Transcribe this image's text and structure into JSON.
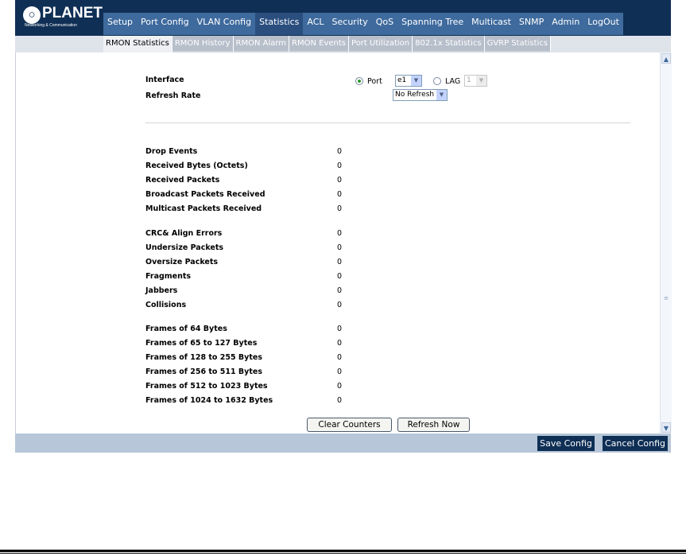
{
  "logo": {
    "word": "PLANET",
    "tagline": "Networking & Communication"
  },
  "main_menu": [
    {
      "label": "Setup",
      "active": false
    },
    {
      "label": "Port Config",
      "active": false
    },
    {
      "label": "VLAN Config",
      "active": false
    },
    {
      "label": "Statistics",
      "active": true
    },
    {
      "label": "ACL",
      "active": false
    },
    {
      "label": "Security",
      "active": false
    },
    {
      "label": "QoS",
      "active": false
    },
    {
      "label": "Spanning Tree",
      "active": false
    },
    {
      "label": "Multicast",
      "active": false
    },
    {
      "label": "SNMP",
      "active": false
    },
    {
      "label": "Admin",
      "active": false
    },
    {
      "label": "LogOut",
      "active": false
    }
  ],
  "sub_menu": [
    {
      "label": "RMON Statistics",
      "active": true
    },
    {
      "label": "RMON History",
      "active": false
    },
    {
      "label": "RMON Alarm",
      "active": false
    },
    {
      "label": "RMON Events",
      "active": false
    },
    {
      "label": "Port Utilization",
      "active": false
    },
    {
      "label": "802.1x Statistics",
      "active": false
    },
    {
      "label": "GVRP Statistics",
      "active": false
    }
  ],
  "form": {
    "interface_label": "Interface",
    "refresh_label": "Refresh Rate",
    "port_radio_label": "Port",
    "port_value": "e1",
    "lag_radio_label": "LAG",
    "lag_value": "1",
    "refresh_value": "No Refresh",
    "selected_interface": "Port"
  },
  "stats": {
    "group1": [
      {
        "label": "Drop Events",
        "value": "0"
      },
      {
        "label": "Received Bytes (Octets)",
        "value": "0"
      },
      {
        "label": "Received Packets",
        "value": "0"
      },
      {
        "label": "Broadcast Packets Received",
        "value": "0"
      },
      {
        "label": "Multicast Packets Received",
        "value": "0"
      }
    ],
    "group2": [
      {
        "label": "CRC& Align Errors",
        "value": "0"
      },
      {
        "label": "Undersize Packets",
        "value": "0"
      },
      {
        "label": "Oversize Packets",
        "value": "0"
      },
      {
        "label": "Fragments",
        "value": "0"
      },
      {
        "label": "Jabbers",
        "value": "0"
      },
      {
        "label": "Collisions",
        "value": "0"
      }
    ],
    "group3": [
      {
        "label": "Frames of 64 Bytes",
        "value": "0"
      },
      {
        "label": "Frames of 65 to 127 Bytes",
        "value": "0"
      },
      {
        "label": "Frames of 128 to 255 Bytes",
        "value": "0"
      },
      {
        "label": "Frames of 256 to 511 Bytes",
        "value": "0"
      },
      {
        "label": "Frames of 512 to 1023 Bytes",
        "value": "0"
      },
      {
        "label": "Frames of 1024 to 1632 Bytes",
        "value": "0"
      }
    ]
  },
  "buttons": {
    "clear": "Clear Counters",
    "refresh": "Refresh Now",
    "save_config": "Save Config",
    "cancel_config": "Cancel Config"
  },
  "colors": {
    "banner": "#0f2f55",
    "menu": "#3e6a9d",
    "active_menu": "#2a4f7f",
    "bottom_bar": "#b7c6d8"
  }
}
